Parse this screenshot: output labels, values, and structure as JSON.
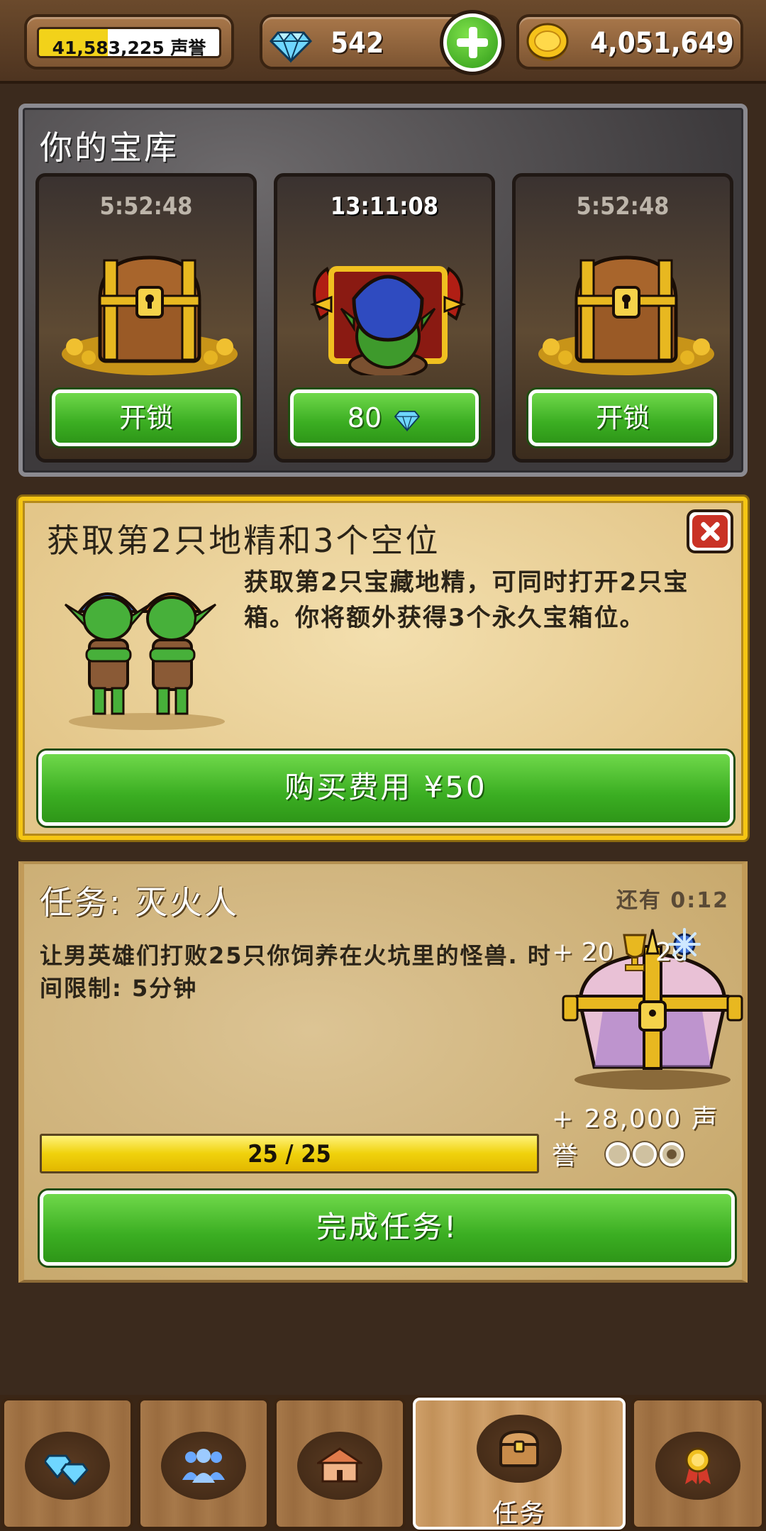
{
  "hud": {
    "reputation_text": "41,583,225 声誉",
    "reputation_progress": 0.38,
    "gems": "542",
    "gold": "4,051,649",
    "icons": {
      "gem": "diamond-icon",
      "gold": "gold-coin-icon",
      "add": "plus-icon"
    }
  },
  "treasury": {
    "title": "你的宝库",
    "chests": [
      {
        "timer": "5:52:48",
        "button": "开锁",
        "art": "treasure-chest-icon"
      },
      {
        "timer": "13:11:08",
        "button": "80",
        "art": "goblin-opening-demon-chest",
        "button_icon": "diamond-icon"
      },
      {
        "timer": "5:52:48",
        "button": "开锁",
        "art": "treasure-chest-icon"
      }
    ]
  },
  "offer": {
    "title": "获取第2只地精和3个空位",
    "description": "获取第2只宝藏地精，可同时打开2只宝箱。你将额外获得3个永久宝箱位。",
    "button": "购买费用 ¥50"
  },
  "mission": {
    "title": "任务: 灭火人",
    "time_left": "还有 0:12",
    "description": "让男英雄们打败25只你饲养在火坑里的怪兽. 时间限制: 5分钟",
    "reward_left": "+ 20",
    "reward_right": "20",
    "reputation_reward": "+ 28,000 声誉",
    "progress_text": "25 / 25",
    "progress": 1.0,
    "stages_completed": 1,
    "stages_total": 3,
    "button": "完成任务!"
  },
  "nav": {
    "tabs": [
      {
        "icon": "gems-icon",
        "label": ""
      },
      {
        "icon": "people-icon",
        "label": ""
      },
      {
        "icon": "house-icon",
        "label": ""
      },
      {
        "icon": "chest-icon",
        "label": "任务"
      },
      {
        "icon": "medal-icon",
        "label": ""
      }
    ]
  },
  "colors": {
    "green_button": "#3bae22",
    "gold_border": "#f5c614",
    "progress_yellow": "#f0d20c",
    "wood": "#a7794a"
  }
}
